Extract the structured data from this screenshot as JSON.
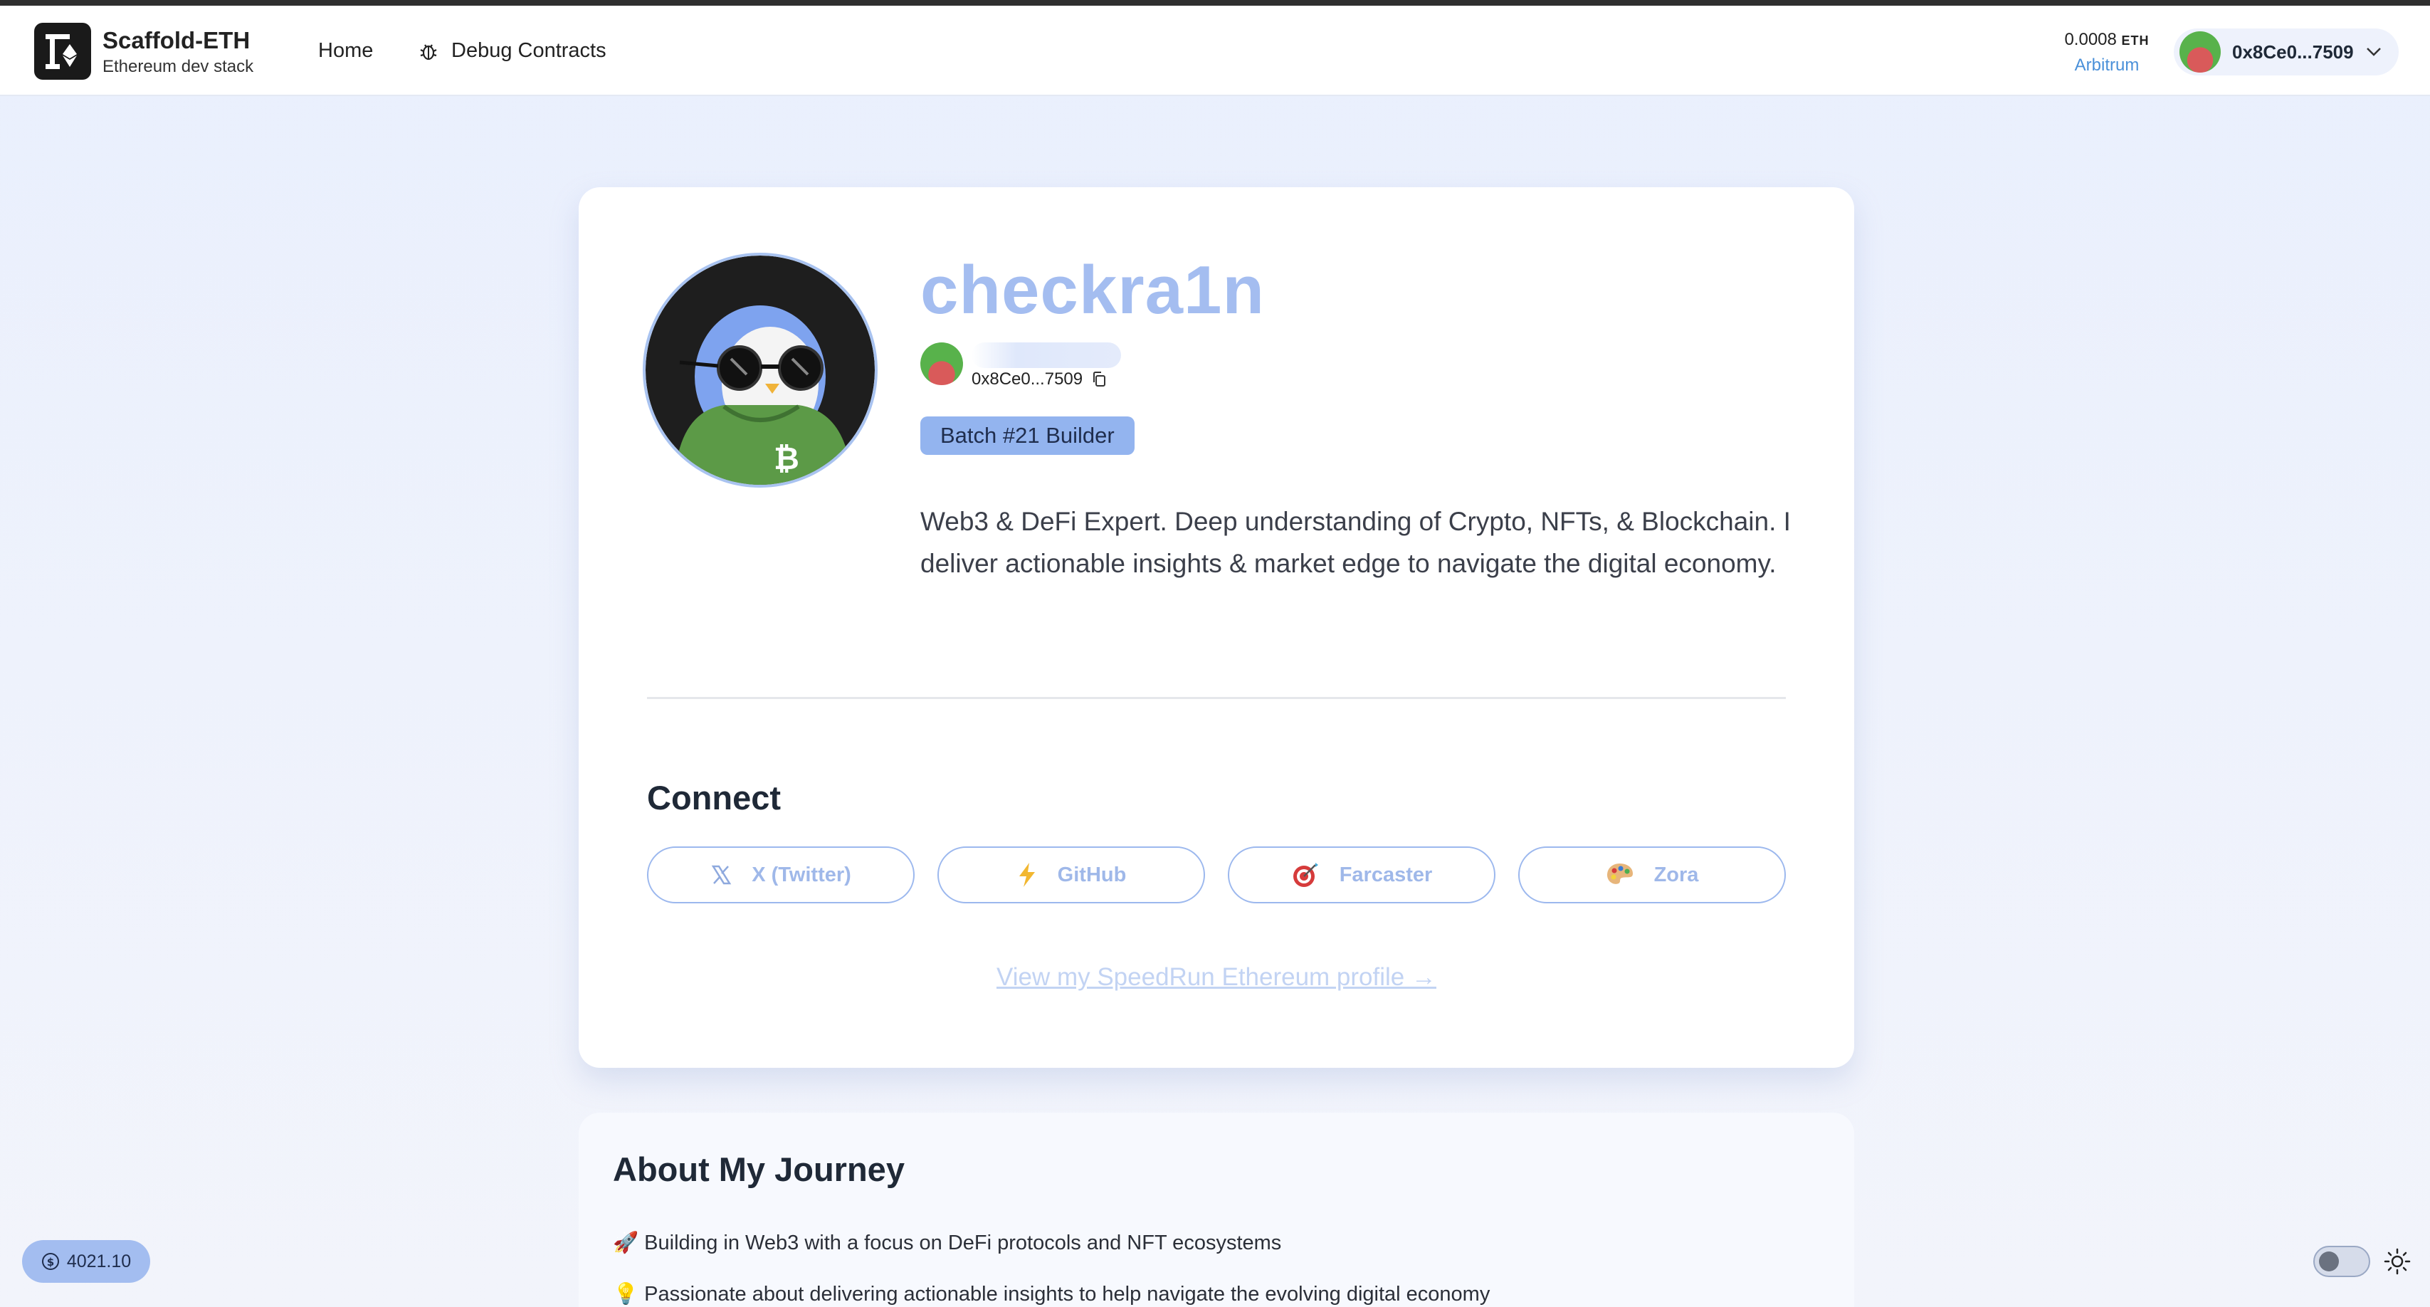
{
  "header": {
    "app_title": "Scaffold-ETH",
    "app_subtitle": "Ethereum dev stack",
    "nav": {
      "home": "Home",
      "debug": "Debug Contracts"
    },
    "balance": {
      "value": "0.0008",
      "unit": "ETH",
      "network": "Arbitrum"
    },
    "wallet_address": "0x8Ce0...7509"
  },
  "profile": {
    "name": "checkra1n",
    "address": "0x8Ce0...7509",
    "badge": "Batch #21 Builder",
    "bio": "Web3 & DeFi Expert. Deep understanding of Crypto, NFTs, & Blockchain. I deliver actionable insights & market edge to navigate the digital economy."
  },
  "connect": {
    "title": "Connect",
    "links": [
      {
        "label": "X (Twitter)",
        "icon": "x-icon"
      },
      {
        "label": "GitHub",
        "icon": "lightning-icon"
      },
      {
        "label": "Farcaster",
        "icon": "target-icon"
      },
      {
        "label": "Zora",
        "icon": "palette-icon"
      }
    ],
    "speedrun_link": "View my SpeedRun Ethereum profile →"
  },
  "journey": {
    "title": "About My Journey",
    "items": [
      "🚀 Building in Web3 with a focus on DeFi protocols and NFT ecosystems",
      "💡 Passionate about delivering actionable insights to help navigate the evolving digital economy"
    ]
  },
  "footer": {
    "eth_price": "4021.10"
  },
  "colors": {
    "accent": "#93b4ef",
    "name": "#a4bdf0",
    "link": "#4a90d9"
  }
}
